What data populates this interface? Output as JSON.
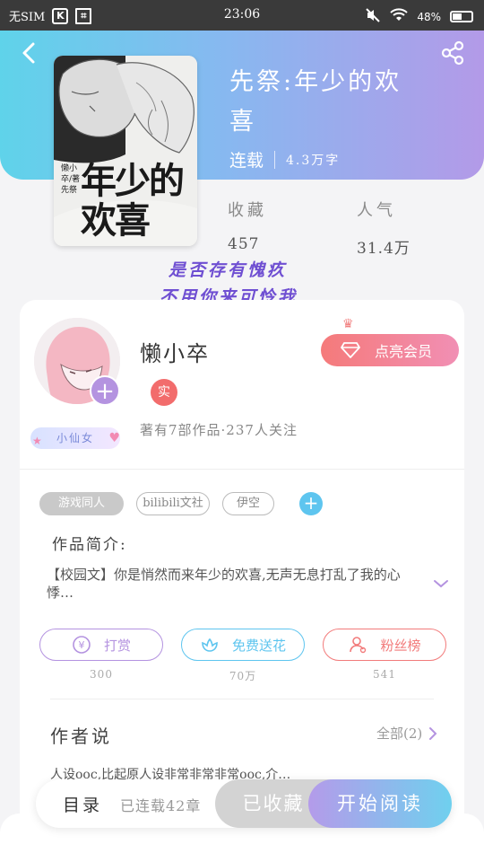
{
  "status_bar": {
    "carrier": "无SIM",
    "time": "23:06",
    "battery": "48%"
  },
  "book": {
    "title": "先祭:年少的欢喜",
    "status": "连载",
    "word_count": "4.3万字",
    "cover_title": "年少的欢喜",
    "cover_author": "懒小卒/著 先祭"
  },
  "stats": {
    "collect_label": "收藏",
    "collect_value": "457",
    "popularity_label": "人气",
    "popularity_value": "31.4万"
  },
  "overlay": {
    "line1": "是否存有愧疚",
    "line2": "不用你来可怜我"
  },
  "author": {
    "name": "懒小卒",
    "verified_label": "实",
    "badge": "小仙女",
    "info": "著有7部作品·237人关注",
    "vip_button": "点亮会员"
  },
  "tags": [
    "游戏同人",
    "bilibili文社",
    "伊空"
  ],
  "intro": {
    "label": "作品简介:",
    "text": "【校园文】你是悄然而来年少的欢喜,无声无息打乱了我的心悸…"
  },
  "actions": [
    {
      "label": "打赏",
      "count": "300",
      "color": "#b493e0"
    },
    {
      "label": "免费送花",
      "count": "70万",
      "color": "#5ec5ef"
    },
    {
      "label": "粉丝榜",
      "count": "541",
      "color": "#f27b7b"
    }
  ],
  "author_says": {
    "title": "作者说",
    "more": "全部(2)",
    "text": "人设ooc,比起原人设非常非常非常ooc,介…"
  },
  "bottom": {
    "catalog": "目录",
    "chapters": "已连载42章",
    "collected": "已收藏",
    "read": "开始阅读"
  }
}
